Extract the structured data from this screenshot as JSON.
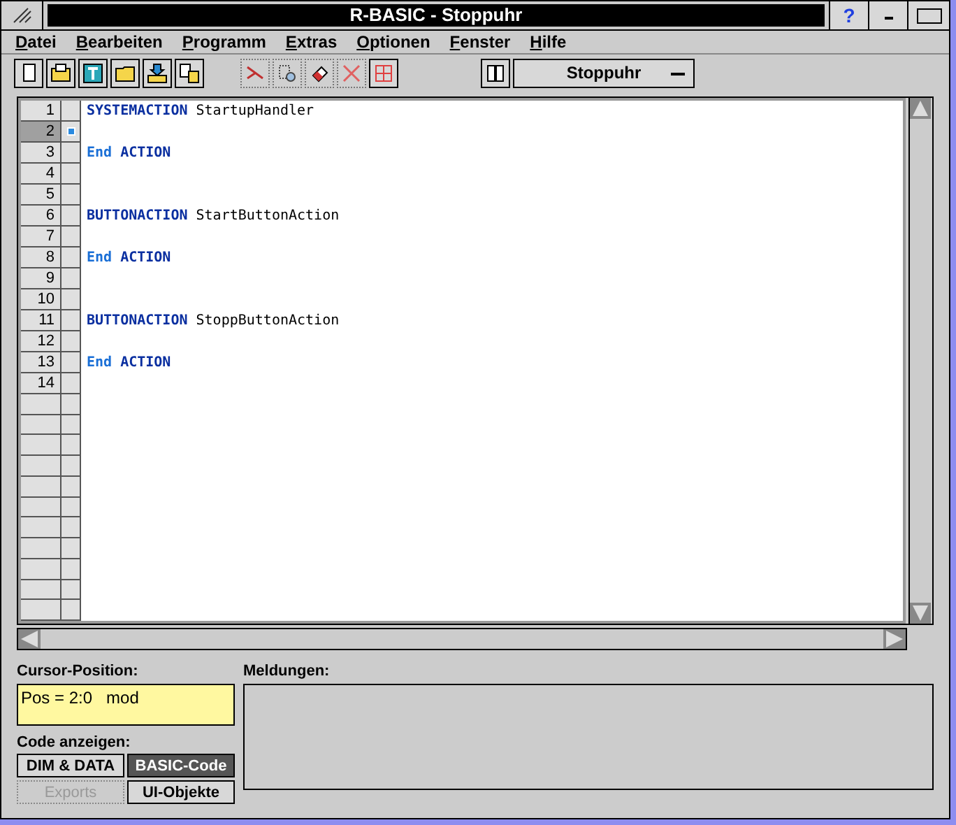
{
  "window": {
    "title": "R-BASIC - Stoppuhr",
    "help": "?"
  },
  "menu": [
    {
      "label": "Datei"
    },
    {
      "label": "Bearbeiten"
    },
    {
      "label": "Programm"
    },
    {
      "label": "Extras"
    },
    {
      "label": "Optionen"
    },
    {
      "label": "Fenster"
    },
    {
      "label": "Hilfe"
    }
  ],
  "toolbar": {
    "module_select": "Stoppuhr"
  },
  "editor": {
    "lines": [
      {
        "number": "1",
        "selected": false,
        "tokens": [
          {
            "kind": "keyword",
            "text": "SYSTEMACTION"
          },
          {
            "kind": "ident",
            "text": "StartupHandler"
          }
        ]
      },
      {
        "number": "2",
        "selected": true
      },
      {
        "number": "3",
        "selected": false,
        "tokens": [
          {
            "kind": "end",
            "text": "End"
          },
          {
            "kind": "keyword",
            "text": "ACTION"
          }
        ]
      },
      {
        "number": "4",
        "selected": false
      },
      {
        "number": "5",
        "selected": false
      },
      {
        "number": "6",
        "selected": false,
        "tokens": [
          {
            "kind": "keyword",
            "text": "BUTTONACTION"
          },
          {
            "kind": "ident",
            "text": "StartButtonAction"
          }
        ]
      },
      {
        "number": "7",
        "selected": false
      },
      {
        "number": "8",
        "selected": false,
        "tokens": [
          {
            "kind": "end",
            "text": "End"
          },
          {
            "kind": "keyword",
            "text": "ACTION"
          }
        ]
      },
      {
        "number": "9",
        "selected": false
      },
      {
        "number": "10",
        "selected": false
      },
      {
        "number": "11",
        "selected": false,
        "tokens": [
          {
            "kind": "keyword",
            "text": "BUTTONACTION"
          },
          {
            "kind": "ident",
            "text": "StoppButtonAction"
          }
        ]
      },
      {
        "number": "12",
        "selected": false
      },
      {
        "number": "13",
        "selected": false,
        "tokens": [
          {
            "kind": "end",
            "text": "End"
          },
          {
            "kind": "keyword",
            "text": "ACTION"
          }
        ]
      },
      {
        "number": "14",
        "selected": false
      }
    ]
  },
  "cursor_position": {
    "label": "Cursor-Position:",
    "value": "Pos = 2:0   mod"
  },
  "messages": {
    "label": "Meldungen:"
  },
  "code_view": {
    "label": "Code anzeigen:",
    "buttons": [
      {
        "label": "DIM & DATA",
        "selected": false,
        "disabled": false
      },
      {
        "label": "BASIC-Code",
        "selected": true,
        "disabled": false
      },
      {
        "label": "Exports",
        "selected": false,
        "disabled": true
      },
      {
        "label": "UI-Objekte",
        "selected": false,
        "disabled": false
      }
    ]
  }
}
